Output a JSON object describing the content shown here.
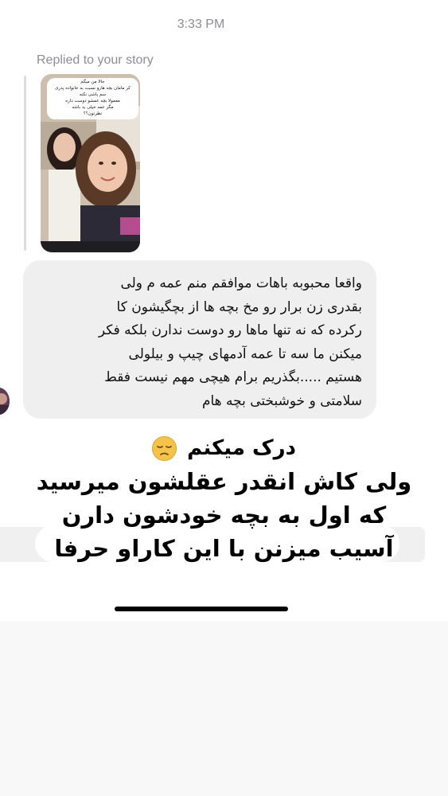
{
  "status_bar": {
    "time": "3:33 PM"
  },
  "story_reply": {
    "label": "Replied to your story",
    "story_text_lines": [
      "حالا من میگم",
      "کر مامان بچه هارو نسبت به خانواده پدری",
      "سم پاشی نکنه",
      "معمولا بچه عمشو دوست داره",
      "مگر عمه خیلی بد باشه",
      "نظرتون؟؟"
    ]
  },
  "message": {
    "lines": [
      "واقعا محبوبه باهات موافقم منم عمه م ولی",
      "بقدری زن برار رو مخ بچه ها از بچگیشون کا",
      "رکرده که نه تنها ماها رو دوست ندارن بلکه فکر",
      "میکنن ما سه تا عمه آدمهای چیپ و بیلولی",
      "هستیم .....بگذریم برام هیچی مهم نیست فقط",
      "سلامتی و خوشبختی بچه هام"
    ]
  },
  "overlay_text": {
    "line1": "درک میکنم",
    "line2": "ولی کاش انقدر عقلشون میرسید",
    "line3": "که اول به بچه خودشون دارن",
    "line4": "آسیب میزنن با این کاراو حرفا",
    "emoji": "pensive-face"
  },
  "colors": {
    "bubble": "#efefef",
    "meta_text": "#8e8e93",
    "emoji_yellow": "#f6c34a"
  }
}
